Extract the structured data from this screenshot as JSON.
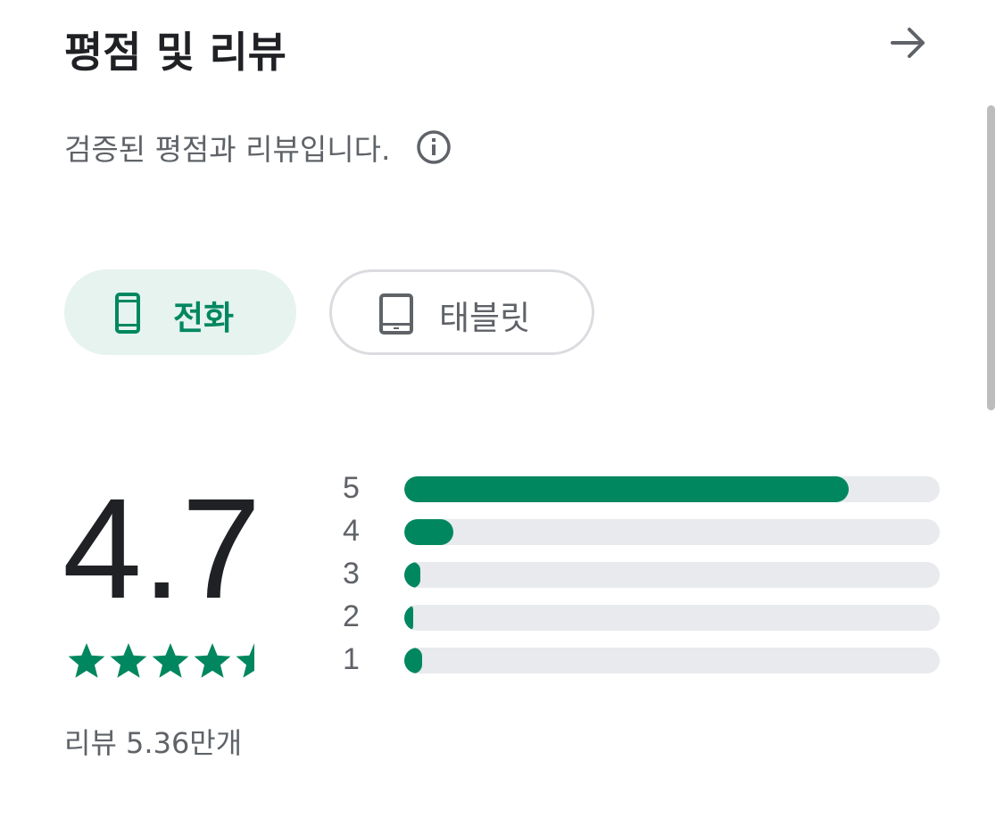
{
  "header": {
    "title": "평점 및 리뷰",
    "arrow_icon": "arrow-right-icon"
  },
  "subtitle": {
    "text": "검증된 평점과 리뷰입니다.",
    "info_icon": "info-icon"
  },
  "device_filter": {
    "chips": [
      {
        "label": "전화",
        "icon": "phone-icon",
        "selected": true
      },
      {
        "label": "태블릿",
        "icon": "tablet-icon",
        "selected": false
      }
    ]
  },
  "rating": {
    "score": "4.7",
    "stars": 4.7,
    "review_count": "리뷰 5.36만개"
  },
  "histogram": {
    "rows": [
      {
        "label": "5",
        "fraction": 0.83
      },
      {
        "label": "4",
        "fraction": 0.092
      },
      {
        "label": "3",
        "fraction": 0.03
      },
      {
        "label": "2",
        "fraction": 0.017
      },
      {
        "label": "1",
        "fraction": 0.033
      }
    ]
  },
  "colors": {
    "accent": "#01875f",
    "chip_selected_bg": "#e6f3ef",
    "track": "#e8eaed",
    "text_primary": "#202124",
    "text_secondary": "#5f6368"
  }
}
